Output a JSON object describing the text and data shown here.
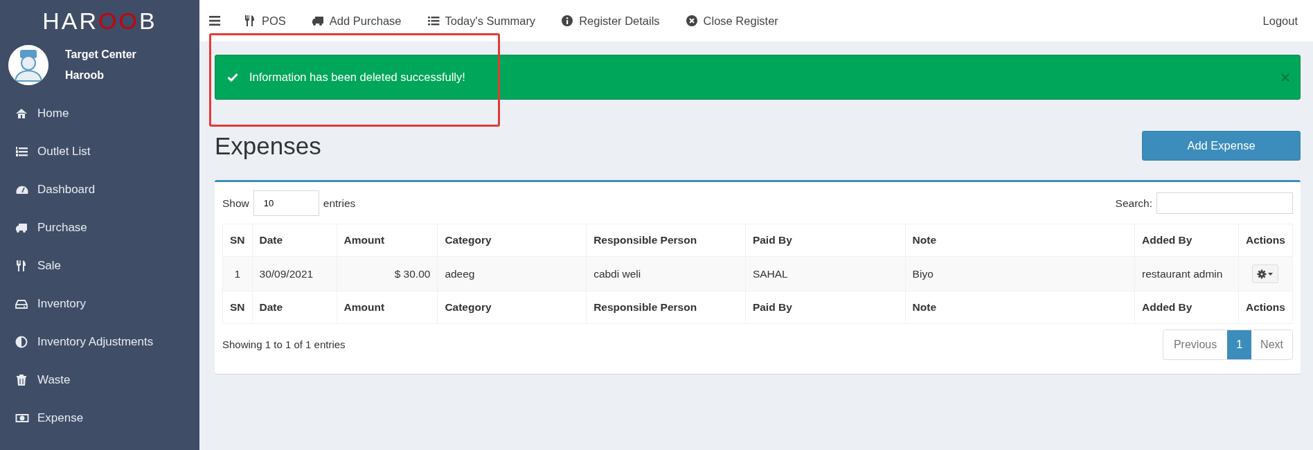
{
  "sidebar": {
    "logo": {
      "parts": [
        {
          "text": "HAR",
          "color": "#ffffff"
        },
        {
          "text": "OO",
          "color": "#c8000a"
        },
        {
          "text": "B",
          "color": "#ffffff"
        }
      ]
    },
    "user": {
      "outlet": "Target Center",
      "name": "Haroob"
    },
    "items": [
      {
        "label": "Home"
      },
      {
        "label": "Outlet List"
      },
      {
        "label": "Dashboard"
      },
      {
        "label": "Purchase"
      },
      {
        "label": "Sale"
      },
      {
        "label": "Inventory"
      },
      {
        "label": "Inventory Adjustments"
      },
      {
        "label": "Waste"
      },
      {
        "label": "Expense"
      }
    ]
  },
  "topbar": {
    "items": [
      {
        "label": "POS"
      },
      {
        "label": "Add Purchase"
      },
      {
        "label": "Today's Summary"
      },
      {
        "label": "Register Details"
      },
      {
        "label": "Close Register"
      }
    ],
    "logout": "Logout"
  },
  "alert": {
    "text": "Information has been deleted successfully!",
    "highlighted": true
  },
  "page_title": "Expenses",
  "add_button": "Add Expense",
  "table": {
    "show_label": "Show",
    "page_size": "10",
    "entries_label": "entries",
    "search_label": "Search:",
    "columns": [
      "SN",
      "Date",
      "Amount",
      "Category",
      "Responsible Person",
      "Paid By",
      "Note",
      "Added By",
      "Actions"
    ],
    "rows": [
      [
        "1",
        "30/09/2021",
        "$ 30.00",
        "adeeg",
        "cabdi weli",
        "SAHAL",
        "Biyo",
        "restaurant admin"
      ]
    ],
    "footer_columns": [
      "SN",
      "Date",
      "Amount",
      "Category",
      "Responsible Person",
      "Paid By",
      "Note",
      "Added By",
      "Actions"
    ],
    "info": "Showing 1 to 1 of 1 entries",
    "previous": "Previous",
    "pages": [
      {
        "label": "1",
        "selected": true
      }
    ],
    "next": "Next"
  }
}
